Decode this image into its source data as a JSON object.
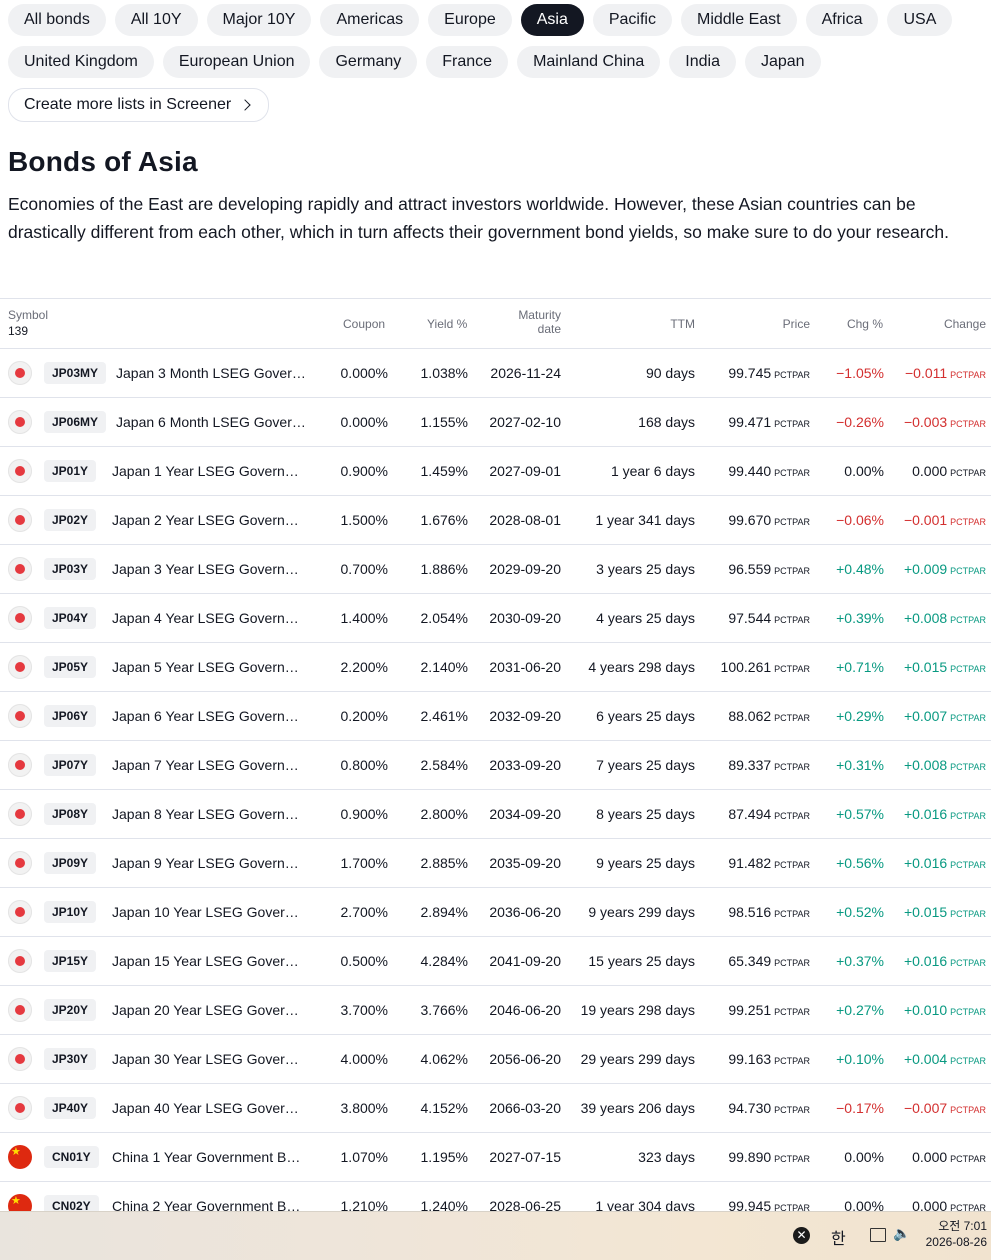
{
  "chips_row1": [
    "All bonds",
    "All 10Y",
    "Major 10Y",
    "Americas",
    "Europe",
    "Asia",
    "Pacific",
    "Middle East",
    "Africa",
    "USA"
  ],
  "chips_row2": [
    "United Kingdom",
    "European Union",
    "Germany",
    "France",
    "Mainland China",
    "India",
    "Japan"
  ],
  "active_chip": "Asia",
  "screener_label": "Create more lists in Screener",
  "title": "Bonds of Asia",
  "description": "Economies of the East are developing rapidly and attract investors worldwide. However, these Asian countries can be drastically different from each other, which in turn affects their government bond yields, so make sure to do your research.",
  "table": {
    "headers": {
      "symbol": "Symbol",
      "count": "139",
      "coupon": "Coupon",
      "yield": "Yield %",
      "maturity_1": "Maturity",
      "maturity_2": "date",
      "ttm": "TTM",
      "price": "Price",
      "chg_pct": "Chg %",
      "change": "Change"
    },
    "unit": "PCTPAR",
    "rows": [
      {
        "flag": "jp",
        "ticker": "JP03MY",
        "name": "Japan 3 Month LSEG Govern…",
        "coupon": "0.000%",
        "yield": "1.038%",
        "maturity": "2026-11-24",
        "ttm": "90 days",
        "price": "99.745",
        "chg_pct": "−1.05%",
        "change": "−0.011",
        "dir": "neg"
      },
      {
        "flag": "jp",
        "ticker": "JP06MY",
        "name": "Japan 6 Month LSEG Govern…",
        "coupon": "0.000%",
        "yield": "1.155%",
        "maturity": "2027-02-10",
        "ttm": "168 days",
        "price": "99.471",
        "chg_pct": "−0.26%",
        "change": "−0.003",
        "dir": "neg"
      },
      {
        "flag": "jp",
        "ticker": "JP01Y",
        "name": "Japan 1 Year LSEG Governm…",
        "coupon": "0.900%",
        "yield": "1.459%",
        "maturity": "2027-09-01",
        "ttm": "1 year 6 days",
        "price": "99.440",
        "chg_pct": "0.00%",
        "change": "0.000",
        "dir": "flat"
      },
      {
        "flag": "jp",
        "ticker": "JP02Y",
        "name": "Japan 2 Year LSEG Governm…",
        "coupon": "1.500%",
        "yield": "1.676%",
        "maturity": "2028-08-01",
        "ttm": "1 year 341 days",
        "price": "99.670",
        "chg_pct": "−0.06%",
        "change": "−0.001",
        "dir": "neg"
      },
      {
        "flag": "jp",
        "ticker": "JP03Y",
        "name": "Japan 3 Year LSEG Governm…",
        "coupon": "0.700%",
        "yield": "1.886%",
        "maturity": "2029-09-20",
        "ttm": "3 years 25 days",
        "price": "96.559",
        "chg_pct": "+0.48%",
        "change": "+0.009",
        "dir": "pos"
      },
      {
        "flag": "jp",
        "ticker": "JP04Y",
        "name": "Japan 4 Year LSEG Governm…",
        "coupon": "1.400%",
        "yield": "2.054%",
        "maturity": "2030-09-20",
        "ttm": "4 years 25 days",
        "price": "97.544",
        "chg_pct": "+0.39%",
        "change": "+0.008",
        "dir": "pos"
      },
      {
        "flag": "jp",
        "ticker": "JP05Y",
        "name": "Japan 5 Year LSEG Governm…",
        "coupon": "2.200%",
        "yield": "2.140%",
        "maturity": "2031-06-20",
        "ttm": "4 years 298 days",
        "price": "100.261",
        "chg_pct": "+0.71%",
        "change": "+0.015",
        "dir": "pos"
      },
      {
        "flag": "jp",
        "ticker": "JP06Y",
        "name": "Japan 6 Year LSEG Governm…",
        "coupon": "0.200%",
        "yield": "2.461%",
        "maturity": "2032-09-20",
        "ttm": "6 years 25 days",
        "price": "88.062",
        "chg_pct": "+0.29%",
        "change": "+0.007",
        "dir": "pos"
      },
      {
        "flag": "jp",
        "ticker": "JP07Y",
        "name": "Japan 7 Year LSEG Governm…",
        "coupon": "0.800%",
        "yield": "2.584%",
        "maturity": "2033-09-20",
        "ttm": "7 years 25 days",
        "price": "89.337",
        "chg_pct": "+0.31%",
        "change": "+0.008",
        "dir": "pos"
      },
      {
        "flag": "jp",
        "ticker": "JP08Y",
        "name": "Japan 8 Year LSEG Governm…",
        "coupon": "0.900%",
        "yield": "2.800%",
        "maturity": "2034-09-20",
        "ttm": "8 years 25 days",
        "price": "87.494",
        "chg_pct": "+0.57%",
        "change": "+0.016",
        "dir": "pos"
      },
      {
        "flag": "jp",
        "ticker": "JP09Y",
        "name": "Japan 9 Year LSEG Governm…",
        "coupon": "1.700%",
        "yield": "2.885%",
        "maturity": "2035-09-20",
        "ttm": "9 years 25 days",
        "price": "91.482",
        "chg_pct": "+0.56%",
        "change": "+0.016",
        "dir": "pos"
      },
      {
        "flag": "jp",
        "ticker": "JP10Y",
        "name": "Japan 10 Year LSEG Govern…",
        "coupon": "2.700%",
        "yield": "2.894%",
        "maturity": "2036-06-20",
        "ttm": "9 years 299 days",
        "price": "98.516",
        "chg_pct": "+0.52%",
        "change": "+0.015",
        "dir": "pos"
      },
      {
        "flag": "jp",
        "ticker": "JP15Y",
        "name": "Japan 15 Year LSEG Govern…",
        "coupon": "0.500%",
        "yield": "4.284%",
        "maturity": "2041-09-20",
        "ttm": "15 years 25 days",
        "price": "65.349",
        "chg_pct": "+0.37%",
        "change": "+0.016",
        "dir": "pos"
      },
      {
        "flag": "jp",
        "ticker": "JP20Y",
        "name": "Japan 20 Year LSEG Govern…",
        "coupon": "3.700%",
        "yield": "3.766%",
        "maturity": "2046-06-20",
        "ttm": "19 years 298 days",
        "price": "99.251",
        "chg_pct": "+0.27%",
        "change": "+0.010",
        "dir": "pos"
      },
      {
        "flag": "jp",
        "ticker": "JP30Y",
        "name": "Japan 30 Year LSEG Govern…",
        "coupon": "4.000%",
        "yield": "4.062%",
        "maturity": "2056-06-20",
        "ttm": "29 years 299 days",
        "price": "99.163",
        "chg_pct": "+0.10%",
        "change": "+0.004",
        "dir": "pos"
      },
      {
        "flag": "jp",
        "ticker": "JP40Y",
        "name": "Japan 40 Year LSEG Govern…",
        "coupon": "3.800%",
        "yield": "4.152%",
        "maturity": "2066-03-20",
        "ttm": "39 years 206 days",
        "price": "94.730",
        "chg_pct": "−0.17%",
        "change": "−0.007",
        "dir": "neg"
      },
      {
        "flag": "cn",
        "ticker": "CN01Y",
        "name": "China 1 Year Government Bo…",
        "coupon": "1.070%",
        "yield": "1.195%",
        "maturity": "2027-07-15",
        "ttm": "323 days",
        "price": "99.890",
        "chg_pct": "0.00%",
        "change": "0.000",
        "dir": "flat"
      },
      {
        "flag": "cn",
        "ticker": "CN02Y",
        "name": "China 2 Year Government Bo…",
        "coupon": "1.210%",
        "yield": "1.240%",
        "maturity": "2028-06-25",
        "ttm": "1 year 304 days",
        "price": "99.945",
        "chg_pct": "0.00%",
        "change": "0.000",
        "dir": "flat"
      }
    ]
  },
  "taskbar": {
    "ime": "한",
    "time": "오전 7:01",
    "date": "2026-08-26",
    "icons": [
      "close-circle-icon",
      "network-icon",
      "volume-icon"
    ]
  },
  "colors": {
    "negative": "#d32f2f",
    "positive": "#089981",
    "active_chip": "#131722"
  }
}
